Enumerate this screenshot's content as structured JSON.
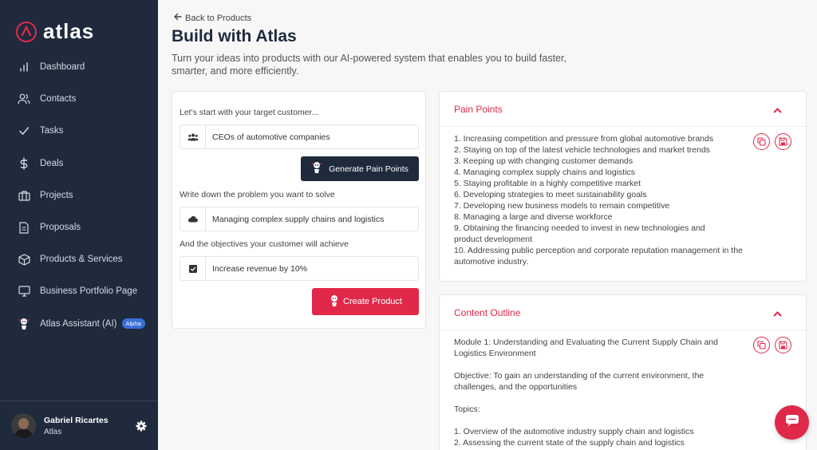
{
  "brand": {
    "name": "atlas",
    "accent": "#e0294a",
    "sidebar_bg": "#1f2a3d"
  },
  "sidebar": {
    "items": [
      {
        "label": "Dashboard",
        "icon": "bar-chart-icon"
      },
      {
        "label": "Contacts",
        "icon": "users-icon"
      },
      {
        "label": "Tasks",
        "icon": "check-icon"
      },
      {
        "label": "Deals",
        "icon": "dollar-icon"
      },
      {
        "label": "Projects",
        "icon": "briefcase-icon"
      },
      {
        "label": "Proposals",
        "icon": "document-icon"
      },
      {
        "label": "Products & Services",
        "icon": "box-icon"
      },
      {
        "label": "Business Portfolio Page",
        "icon": "monitor-icon"
      },
      {
        "label": "Atlas Assistant (AI)",
        "icon": "robot-icon",
        "badge": "Alpha"
      }
    ]
  },
  "user": {
    "name": "Gabriel Ricartes",
    "org": "Atlas"
  },
  "header": {
    "back": "Back to Products",
    "title": "Build with Atlas",
    "subtitle": "Turn your ideas into products with our AI-powered system that enables you to build faster, smarter, and more efficiently."
  },
  "form": {
    "customer_label": "Let's start with your target customer...",
    "customer_value": "CEOs of automotive companies",
    "generate_button": "Generate Pain Points",
    "problem_label": "Write down the problem you want to solve",
    "problem_value": "Managing complex supply chains and logistics",
    "objective_label": "And the objectives your customer will achieve",
    "objective_value": "Increase revenue by 10%",
    "create_button": "Create Product"
  },
  "pain_points": {
    "title": "Pain Points",
    "items": [
      "1. Increasing competition and pressure from global automotive brands",
      "2. Staying on top of the latest vehicle technologies and market trends",
      "3. Keeping up with changing customer demands",
      "4. Managing complex supply chains and logistics",
      "5. Staying profitable in a highly competitive market",
      "6. Developing strategies to meet sustainability goals",
      "7. Developing new business models to remain competitive",
      "8. Managing a large and diverse workforce",
      "9. Obtaining the financing needed to invest in new technologies and product development",
      "10. Addressing public perception and corporate reputation management in the automotive industry."
    ]
  },
  "content_outline": {
    "title": "Content Outline",
    "module": "Module 1: Understanding and Evaluating the Current Supply Chain and Logistics Environment",
    "objective": "Objective: To gain an understanding of the current environment, the challenges, and the opportunities",
    "topics_label": "Topics:",
    "topics": [
      "1. Overview of the automotive industry supply chain and logistics",
      "2. Assessing the current state of the supply chain and logistics"
    ]
  }
}
